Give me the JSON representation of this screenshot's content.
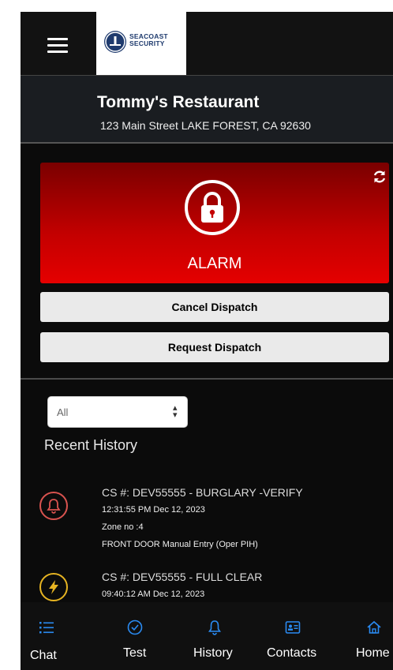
{
  "brand": {
    "line1": "SEACOAST",
    "line2": "SECURITY"
  },
  "site": {
    "name": "Tommy's Restaurant",
    "address": "123 Main Street LAKE FOREST, CA 92630"
  },
  "alarm": {
    "status": "ALARM",
    "color": "#d40000"
  },
  "actions": {
    "cancel_dispatch": "Cancel Dispatch",
    "request_dispatch": "Request Dispatch"
  },
  "filter": {
    "selected": "All"
  },
  "history": {
    "title": "Recent History",
    "items": [
      {
        "icon": "bell-icon",
        "color": "#d9534f",
        "title": "CS #: DEV55555 - BURGLARY -VERIFY",
        "time": "12:31:55 PM Dec 12, 2023",
        "zone": "Zone no :4",
        "detail": "FRONT DOOR Manual Entry (Oper PIH)"
      },
      {
        "icon": "lightning-icon",
        "color": "#e6b422",
        "title": "CS #: DEV55555 - FULL CLEAR",
        "time": "09:40:12 AM Dec 12, 2023"
      }
    ]
  },
  "nav": {
    "chat": "Chat",
    "test": "Test",
    "history": "History",
    "contacts": "Contacts",
    "home": "Home",
    "icon_color": "#2a8bf2"
  }
}
